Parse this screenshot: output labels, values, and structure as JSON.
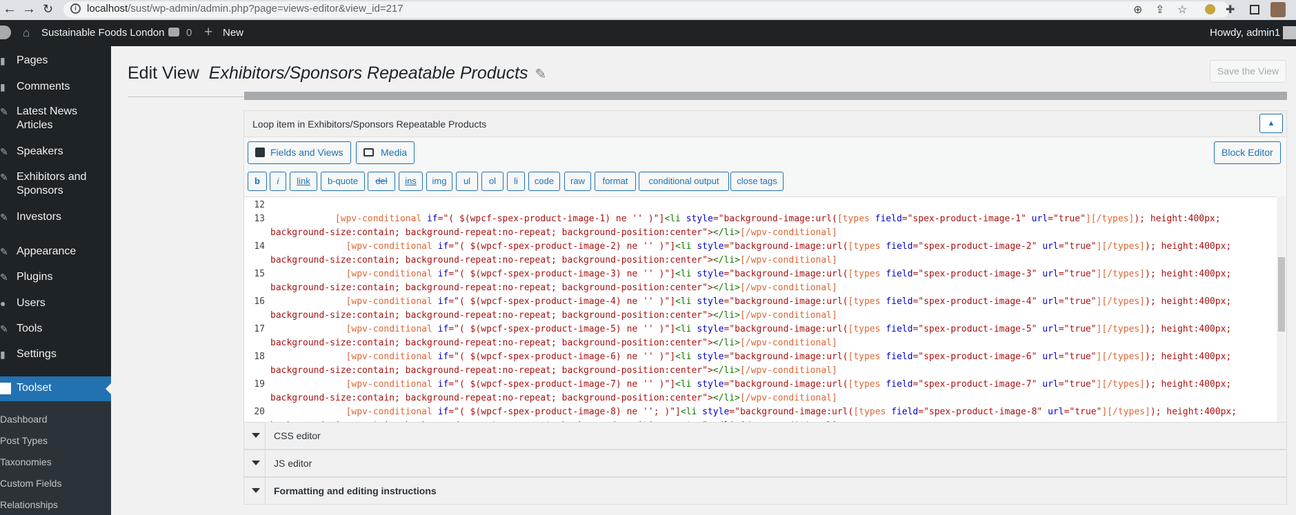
{
  "browser": {
    "url_host": "localhost",
    "url_path": "/sust/wp-admin/admin.php?page=views-editor&view_id=217",
    "icons": [
      "back-icon",
      "forward-icon",
      "reload-icon",
      "info-icon",
      "zoom-icon",
      "share-icon",
      "star-icon",
      "extension-icon",
      "puzzle-icon",
      "sidebar-icon",
      "profile-icon"
    ]
  },
  "adminbar": {
    "site_name": "Sustainable Foods London",
    "comments_count": "0",
    "new_label": "New",
    "howdy": "Howdy, admin1"
  },
  "sidemenu": {
    "items": [
      {
        "label": "Pages"
      },
      {
        "label": "Comments"
      },
      {
        "label": "Latest News",
        "label2": "Articles"
      },
      {
        "label": "Speakers"
      },
      {
        "label": "Exhibitors and",
        "label2": "Sponsors"
      },
      {
        "label": "Investors"
      },
      {
        "label": "Appearance"
      },
      {
        "label": "Plugins"
      },
      {
        "label": "Users"
      },
      {
        "label": "Tools"
      },
      {
        "label": "Settings"
      }
    ],
    "active": "Toolset",
    "submenu": [
      "Dashboard",
      "Post Types",
      "Taxonomies",
      "Custom Fields",
      "Relationships"
    ]
  },
  "main": {
    "title": "Edit View",
    "view_name": "Exhibitors/Sponsors Repeatable Products",
    "save_label": "Save the View",
    "panel_title": "Loop item in Exhibitors/Sponsors Repeatable Products",
    "collapse_label": "▲",
    "fields_btn": "Fields and Views",
    "media_btn": "Media",
    "block_editor_btn": "Block Editor",
    "quicktags": [
      "b",
      "i",
      "link",
      "b-quote",
      "del",
      "ins",
      "img",
      "ul",
      "ol",
      "li",
      "code",
      "raw",
      "format",
      "conditional output",
      "close tags"
    ],
    "code_lines": [
      {
        "n": "12",
        "l1": "",
        "l2": ""
      },
      {
        "n": "13",
        "indent": "            ",
        "img": "1",
        "sep": " ne '' )"
      },
      {
        "n": "14",
        "indent": "              ",
        "img": "2",
        "sep": " ne '' )"
      },
      {
        "n": "15",
        "indent": "              ",
        "img": "3",
        "sep": " ne '' )"
      },
      {
        "n": "16",
        "indent": "              ",
        "img": "4",
        "sep": " ne '' )"
      },
      {
        "n": "17",
        "indent": "              ",
        "img": "5",
        "sep": " ne '' )"
      },
      {
        "n": "18",
        "indent": "              ",
        "img": "6",
        "sep": " ne '' )"
      },
      {
        "n": "19",
        "indent": "              ",
        "img": "7",
        "sep": " ne '' )"
      },
      {
        "n": "20",
        "indent": "              ",
        "img": "8",
        "sep": " ne ''; )"
      }
    ],
    "accordions": [
      "CSS editor",
      "JS editor",
      "Formatting and editing instructions"
    ]
  }
}
